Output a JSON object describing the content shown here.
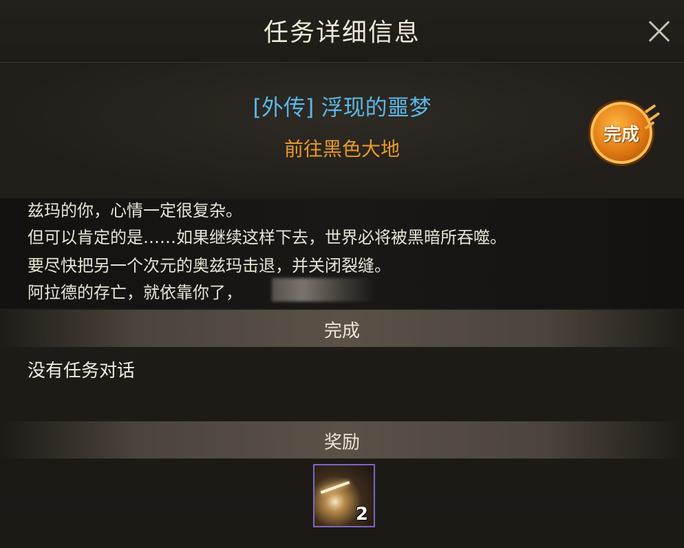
{
  "window": {
    "title": "任务详细信息"
  },
  "quest": {
    "name": "[外传] 浮现的噩梦",
    "goal": "前往黑色大地",
    "status_badge": "完成"
  },
  "dialog": {
    "lines": [
      "兹玛的你，心情一定很复杂。",
      "但可以肯定的是……如果继续这样下去，世界必将被黑暗所吞噬。",
      "要尽快把另一个次元的奥兹玛击退，并关闭裂缝。",
      "阿拉德的存亡，就依靠你了，"
    ]
  },
  "sections": {
    "complete_label": "完成",
    "no_dialog_text": "没有任务对话",
    "reward_label": "奖励"
  },
  "reward": {
    "count": "2"
  },
  "colors": {
    "quest_name": "#5ab8e6",
    "quest_goal": "#e89a2a",
    "badge": "#e07a12",
    "reward_border": "#7a68c4"
  }
}
